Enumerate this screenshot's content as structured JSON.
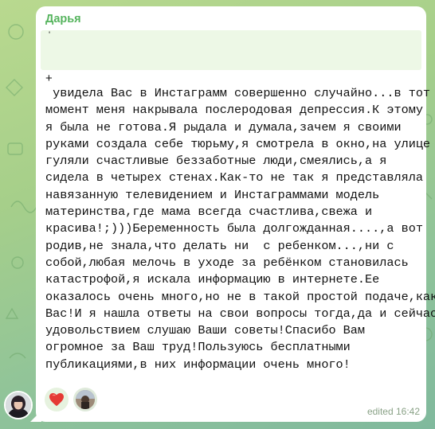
{
  "message": {
    "sender": "Дарья",
    "quote_marker": "'",
    "plus": "+",
    "lines": [
      " увидела Вас в Инстаграмм совершенно случайно...в тот",
      "момент меня накрывала послеродовая депрессия.К этому",
      "я была не готова.Я рыдала и думала,зачем я своими",
      "руками создала себе тюрьму,я смотрела в окно,на улице",
      "гуляли счастливые беззаботные люди,смеялись,а я",
      "сидела в четырех стенах.Как-то не так я представляла",
      "навязанную телевидением и Инстаграммами модель",
      "материнства,где мама всегда счастлива,свежа и",
      "красива!;)))Беременность была долгожданная....,а вот",
      "родив,не знала,что делать ни  с ребенком...,ни с",
      "собой,любая мелочь в уходе за ребёнком становилась",
      "катастрофой,я искала информацию в интернете.Ее",
      "оказалось очень много,но не в такой простой подаче,как у",
      "Вас!И я нашла ответы на свои вопросы тогда,да и сейчас с",
      "удовольствием слушаю Ваши советы!Спасибо Вам",
      "огромное за Ваш труд!Пользуюсь бесплатными",
      "публикациями,в них информации очень много!"
    ],
    "timestamp": "edited 16:42"
  },
  "reactions": [
    {
      "icon": "heart-icon",
      "color": "#e53935"
    },
    {
      "icon": "reactor-avatar"
    }
  ],
  "colors": {
    "sender": "#56b45e",
    "quote_bg": "#edf8e6",
    "bubble": "#ffffff",
    "timestamp": "#8aa287"
  }
}
